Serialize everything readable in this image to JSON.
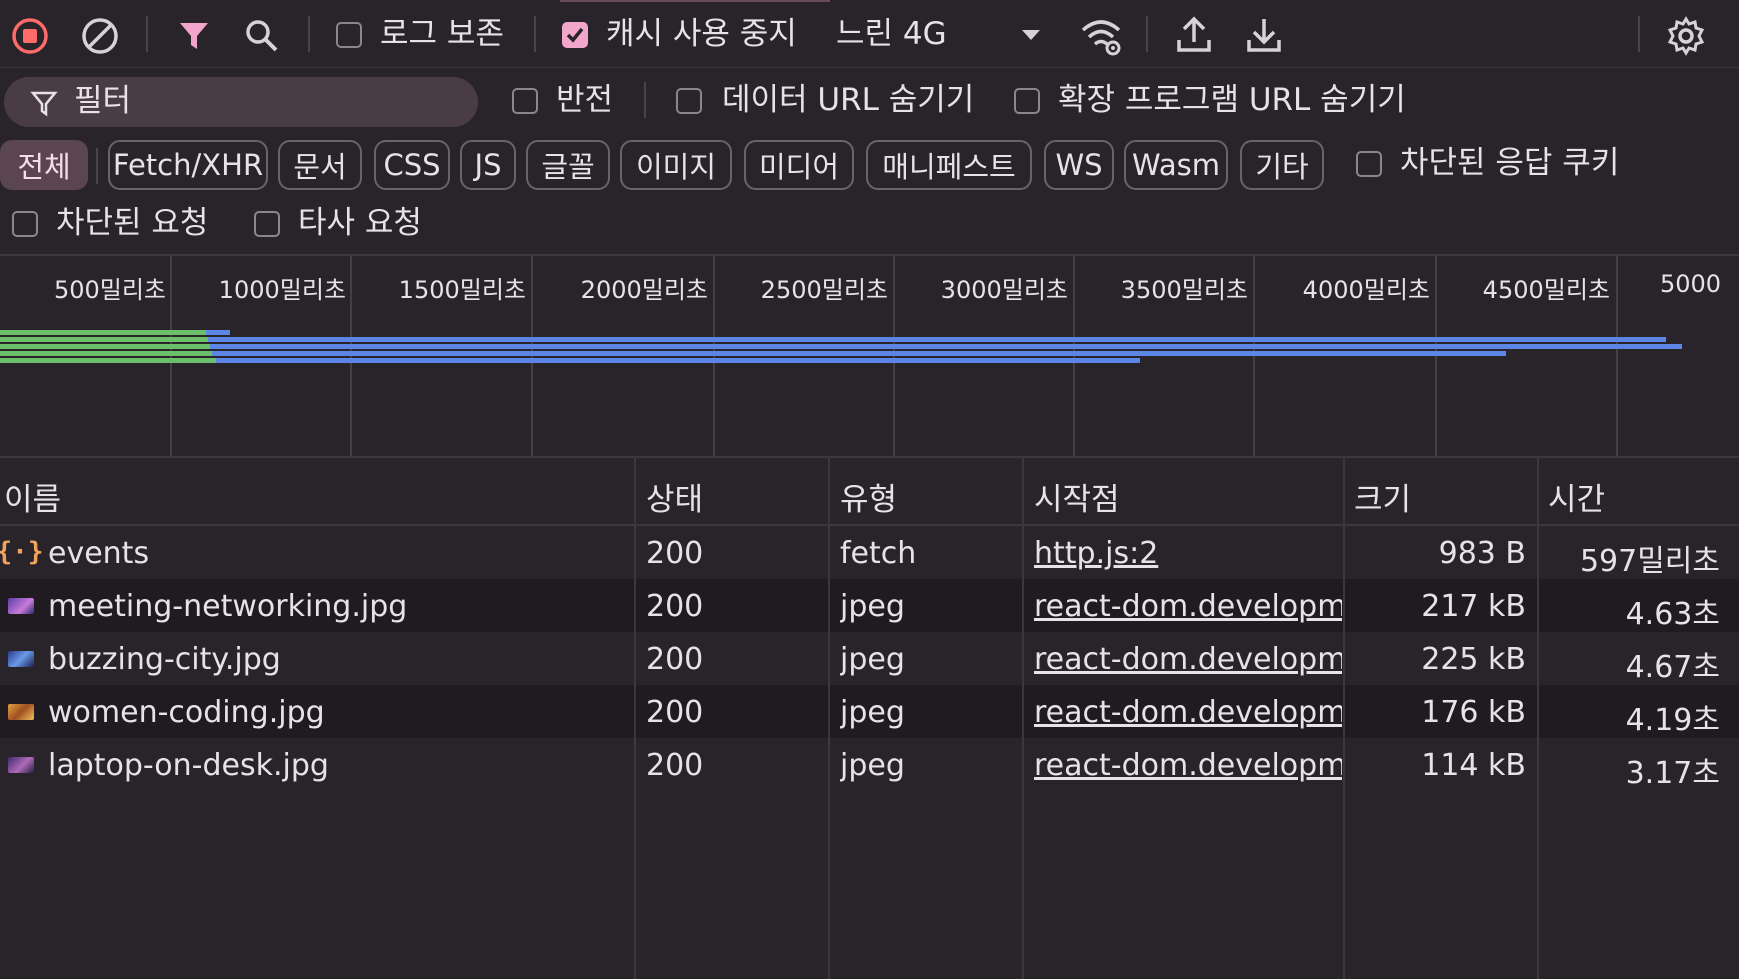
{
  "toolbar": {
    "preserve_log_label": "로그 보존",
    "preserve_log_checked": false,
    "disable_cache_label": "캐시 사용 중지",
    "disable_cache_checked": true,
    "throttling_value": "느린 4G",
    "accent_color": "#f2a6cc",
    "record_color": "#ff6b6b"
  },
  "filter_bar": {
    "placeholder": "필터",
    "invert_label": "반전",
    "hide_data_urls_label": "데이터 URL 숨기기",
    "hide_extension_urls_label": "확장 프로그램 URL 숨기기"
  },
  "type_filters": {
    "chips": [
      "전체",
      "Fetch/XHR",
      "문서",
      "CSS",
      "JS",
      "글꼴",
      "이미지",
      "미디어",
      "매니페스트",
      "WS",
      "Wasm",
      "기타"
    ],
    "active": "전체",
    "blocked_cookies_label": "차단된 응답 쿠키"
  },
  "extra_filters": {
    "blocked_requests_label": "차단된 요청",
    "third_party_label": "타사 요청"
  },
  "timeline": {
    "ticks": [
      "500밀리초",
      "1000밀리초",
      "1500밀리초",
      "2000밀리초",
      "2500밀리초",
      "3000밀리초",
      "3500밀리초",
      "4000밀리초",
      "4500밀리초",
      "5000"
    ]
  },
  "table": {
    "headers": {
      "name": "이름",
      "status": "상태",
      "type": "유형",
      "initiator": "시작점",
      "size": "크기",
      "time": "시간"
    },
    "rows": [
      {
        "name": "events",
        "status": "200",
        "type": "fetch",
        "initiator": "http.js:2",
        "size": "983 B",
        "time": "597밀리초",
        "icon": "fetch-icon"
      },
      {
        "name": "meeting-networking.jpg",
        "status": "200",
        "type": "jpeg",
        "initiator": "react-dom.development.js",
        "size": "217 kB",
        "time": "4.63초",
        "icon": "image-thumbnail"
      },
      {
        "name": "buzzing-city.jpg",
        "status": "200",
        "type": "jpeg",
        "initiator": "react-dom.development.js",
        "size": "225 kB",
        "time": "4.67초",
        "icon": "image-thumbnail"
      },
      {
        "name": "women-coding.jpg",
        "status": "200",
        "type": "jpeg",
        "initiator": "react-dom.development.js",
        "size": "176 kB",
        "time": "4.19초",
        "icon": "image-thumbnail"
      },
      {
        "name": "laptop-on-desk.jpg",
        "status": "200",
        "type": "jpeg",
        "initiator": "react-dom.development.js",
        "size": "114 kB",
        "time": "3.17초",
        "icon": "image-thumbnail"
      }
    ]
  }
}
